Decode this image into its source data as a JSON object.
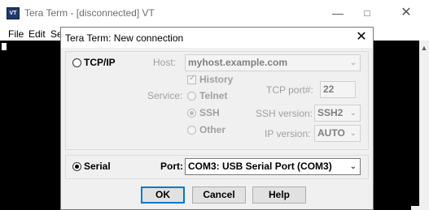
{
  "window": {
    "app_icon": "VT",
    "title": "Tera Term - [disconnected] VT",
    "controls": [
      "minimize-icon",
      "maximize-icon",
      "close-icon"
    ]
  },
  "menubar": {
    "items": [
      "File",
      "Edit",
      "Set"
    ]
  },
  "dialog": {
    "title": "Tera Term: New connection",
    "close": "✕",
    "tcpip": {
      "label": "TCP/IP",
      "selected": false,
      "host_label": "Host:",
      "host_value": "myhost.example.com",
      "history_label": "History",
      "history_checked": true,
      "service_label": "Service:",
      "services": [
        "Telnet",
        "SSH",
        "Other"
      ],
      "service_selected": "SSH",
      "tcp_port_label": "TCP port#:",
      "tcp_port_value": "22",
      "ssh_version_label": "SSH version:",
      "ssh_version_value": "SSH2",
      "ip_version_label": "IP version:",
      "ip_version_value": "AUTO"
    },
    "serial": {
      "label": "Serial",
      "selected": true,
      "port_label": "Port:",
      "port_value": "COM3: USB Serial Port (COM3)"
    },
    "buttons": {
      "ok": "OK",
      "cancel": "Cancel",
      "help": "Help"
    }
  }
}
